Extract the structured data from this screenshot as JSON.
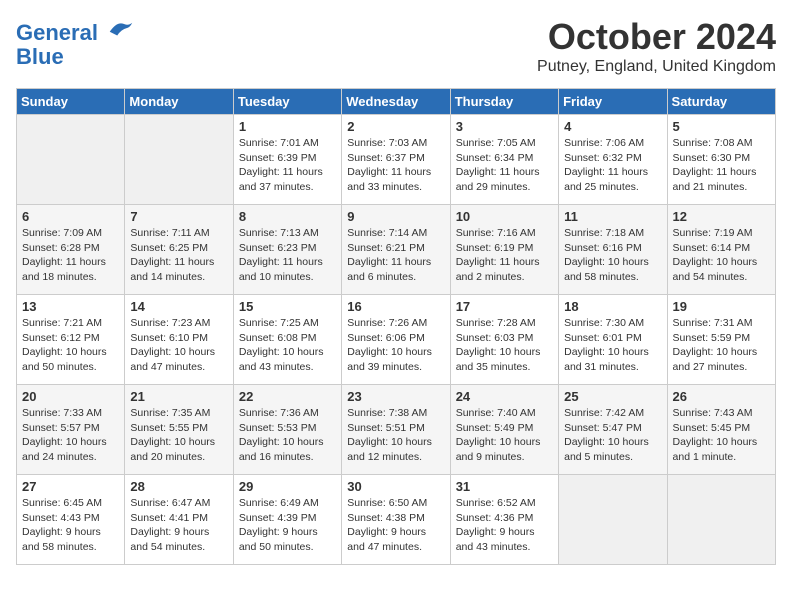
{
  "logo": {
    "line1": "General",
    "line2": "Blue"
  },
  "title": "October 2024",
  "location": "Putney, England, United Kingdom",
  "weekdays": [
    "Sunday",
    "Monday",
    "Tuesday",
    "Wednesday",
    "Thursday",
    "Friday",
    "Saturday"
  ],
  "weeks": [
    [
      {
        "day": "",
        "info": ""
      },
      {
        "day": "",
        "info": ""
      },
      {
        "day": "1",
        "info": "Sunrise: 7:01 AM\nSunset: 6:39 PM\nDaylight: 11 hours and 37 minutes."
      },
      {
        "day": "2",
        "info": "Sunrise: 7:03 AM\nSunset: 6:37 PM\nDaylight: 11 hours and 33 minutes."
      },
      {
        "day": "3",
        "info": "Sunrise: 7:05 AM\nSunset: 6:34 PM\nDaylight: 11 hours and 29 minutes."
      },
      {
        "day": "4",
        "info": "Sunrise: 7:06 AM\nSunset: 6:32 PM\nDaylight: 11 hours and 25 minutes."
      },
      {
        "day": "5",
        "info": "Sunrise: 7:08 AM\nSunset: 6:30 PM\nDaylight: 11 hours and 21 minutes."
      }
    ],
    [
      {
        "day": "6",
        "info": "Sunrise: 7:09 AM\nSunset: 6:28 PM\nDaylight: 11 hours and 18 minutes."
      },
      {
        "day": "7",
        "info": "Sunrise: 7:11 AM\nSunset: 6:25 PM\nDaylight: 11 hours and 14 minutes."
      },
      {
        "day": "8",
        "info": "Sunrise: 7:13 AM\nSunset: 6:23 PM\nDaylight: 11 hours and 10 minutes."
      },
      {
        "day": "9",
        "info": "Sunrise: 7:14 AM\nSunset: 6:21 PM\nDaylight: 11 hours and 6 minutes."
      },
      {
        "day": "10",
        "info": "Sunrise: 7:16 AM\nSunset: 6:19 PM\nDaylight: 11 hours and 2 minutes."
      },
      {
        "day": "11",
        "info": "Sunrise: 7:18 AM\nSunset: 6:16 PM\nDaylight: 10 hours and 58 minutes."
      },
      {
        "day": "12",
        "info": "Sunrise: 7:19 AM\nSunset: 6:14 PM\nDaylight: 10 hours and 54 minutes."
      }
    ],
    [
      {
        "day": "13",
        "info": "Sunrise: 7:21 AM\nSunset: 6:12 PM\nDaylight: 10 hours and 50 minutes."
      },
      {
        "day": "14",
        "info": "Sunrise: 7:23 AM\nSunset: 6:10 PM\nDaylight: 10 hours and 47 minutes."
      },
      {
        "day": "15",
        "info": "Sunrise: 7:25 AM\nSunset: 6:08 PM\nDaylight: 10 hours and 43 minutes."
      },
      {
        "day": "16",
        "info": "Sunrise: 7:26 AM\nSunset: 6:06 PM\nDaylight: 10 hours and 39 minutes."
      },
      {
        "day": "17",
        "info": "Sunrise: 7:28 AM\nSunset: 6:03 PM\nDaylight: 10 hours and 35 minutes."
      },
      {
        "day": "18",
        "info": "Sunrise: 7:30 AM\nSunset: 6:01 PM\nDaylight: 10 hours and 31 minutes."
      },
      {
        "day": "19",
        "info": "Sunrise: 7:31 AM\nSunset: 5:59 PM\nDaylight: 10 hours and 27 minutes."
      }
    ],
    [
      {
        "day": "20",
        "info": "Sunrise: 7:33 AM\nSunset: 5:57 PM\nDaylight: 10 hours and 24 minutes."
      },
      {
        "day": "21",
        "info": "Sunrise: 7:35 AM\nSunset: 5:55 PM\nDaylight: 10 hours and 20 minutes."
      },
      {
        "day": "22",
        "info": "Sunrise: 7:36 AM\nSunset: 5:53 PM\nDaylight: 10 hours and 16 minutes."
      },
      {
        "day": "23",
        "info": "Sunrise: 7:38 AM\nSunset: 5:51 PM\nDaylight: 10 hours and 12 minutes."
      },
      {
        "day": "24",
        "info": "Sunrise: 7:40 AM\nSunset: 5:49 PM\nDaylight: 10 hours and 9 minutes."
      },
      {
        "day": "25",
        "info": "Sunrise: 7:42 AM\nSunset: 5:47 PM\nDaylight: 10 hours and 5 minutes."
      },
      {
        "day": "26",
        "info": "Sunrise: 7:43 AM\nSunset: 5:45 PM\nDaylight: 10 hours and 1 minute."
      }
    ],
    [
      {
        "day": "27",
        "info": "Sunrise: 6:45 AM\nSunset: 4:43 PM\nDaylight: 9 hours and 58 minutes."
      },
      {
        "day": "28",
        "info": "Sunrise: 6:47 AM\nSunset: 4:41 PM\nDaylight: 9 hours and 54 minutes."
      },
      {
        "day": "29",
        "info": "Sunrise: 6:49 AM\nSunset: 4:39 PM\nDaylight: 9 hours and 50 minutes."
      },
      {
        "day": "30",
        "info": "Sunrise: 6:50 AM\nSunset: 4:38 PM\nDaylight: 9 hours and 47 minutes."
      },
      {
        "day": "31",
        "info": "Sunrise: 6:52 AM\nSunset: 4:36 PM\nDaylight: 9 hours and 43 minutes."
      },
      {
        "day": "",
        "info": ""
      },
      {
        "day": "",
        "info": ""
      }
    ]
  ]
}
